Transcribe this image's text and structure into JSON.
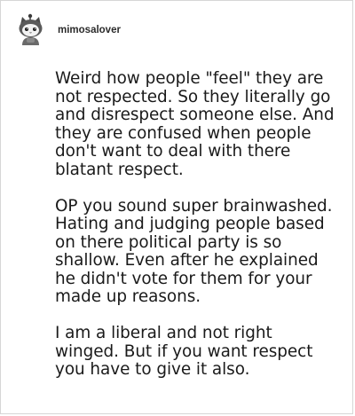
{
  "post": {
    "username": "mimosalover",
    "avatar_icon": "gray-cat-avatar-icon",
    "paragraphs": [
      "Weird how people \"feel\" they are not respected. So they literally go and disrespect someone else. And they are confused when people don't want to deal with there blatant respect.",
      "OP you sound super brainwashed. Hating and judging people based on there political party is so shallow. Even after he explained he didn't vote for them for your made up reasons.",
      "I am a liberal and not right winged. But if you want respect you have to give it also."
    ]
  },
  "colors": {
    "border": "#d6d6d6",
    "text": "#1a1a1a",
    "username": "#2b2b2b"
  }
}
